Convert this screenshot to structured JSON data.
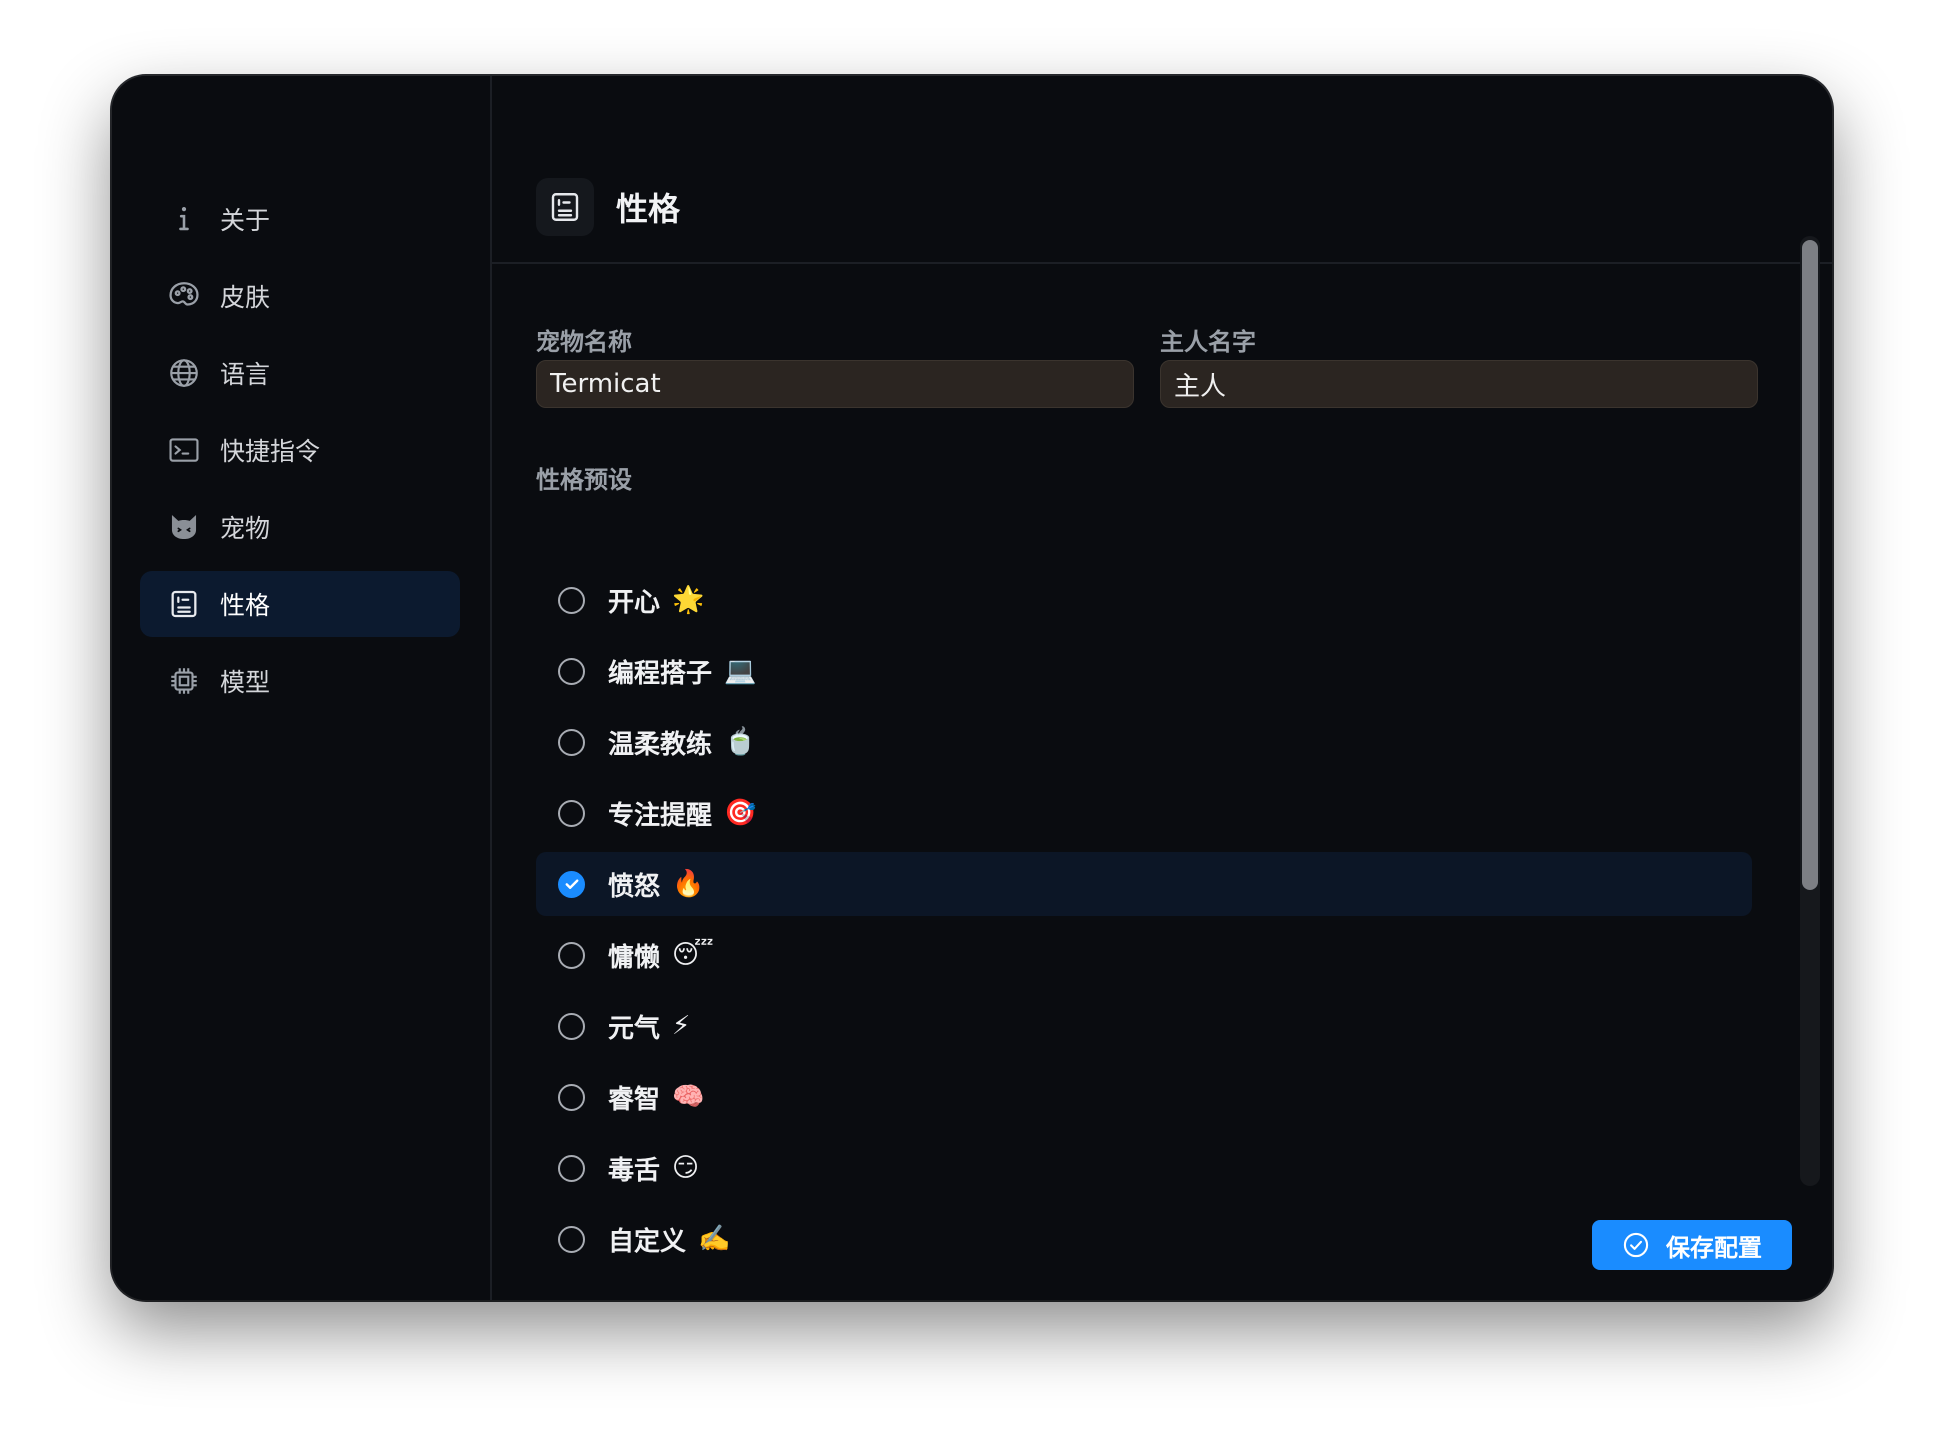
{
  "sidebar": {
    "items": [
      {
        "label": "关于",
        "icon": "info-icon"
      },
      {
        "label": "皮肤",
        "icon": "palette-icon"
      },
      {
        "label": "语言",
        "icon": "globe-icon"
      },
      {
        "label": "快捷指令",
        "icon": "terminal-icon"
      },
      {
        "label": "宠物",
        "icon": "cat-icon"
      },
      {
        "label": "性格",
        "icon": "personality-card-icon",
        "active": true
      },
      {
        "label": "模型",
        "icon": "chip-icon"
      }
    ]
  },
  "header": {
    "title": "性格",
    "icon": "personality-card-icon"
  },
  "form": {
    "pet_name": {
      "label": "宠物名称",
      "value": "Termicat"
    },
    "owner_name": {
      "label": "主人名字",
      "value": "主人"
    },
    "preset_label": "性格预设",
    "presets": [
      {
        "label": "开心",
        "emoji": "🌟",
        "selected": false
      },
      {
        "label": "编程搭子",
        "emoji": "💻",
        "selected": false
      },
      {
        "label": "温柔教练",
        "emoji": "🍵",
        "selected": false
      },
      {
        "label": "专注提醒",
        "emoji": "🎯",
        "selected": false
      },
      {
        "label": "愤怒",
        "emoji": "🔥",
        "selected": true
      },
      {
        "label": "慵懒",
        "emoji": "😴",
        "selected": false
      },
      {
        "label": "元气",
        "emoji": "⚡",
        "selected": false
      },
      {
        "label": "睿智",
        "emoji": "🧠",
        "selected": false
      },
      {
        "label": "毒舌",
        "emoji": "😏",
        "selected": false
      },
      {
        "label": "自定义",
        "emoji": "✍️",
        "selected": false
      }
    ]
  },
  "actions": {
    "save_label": "保存配置"
  },
  "colors": {
    "accent": "#1a8cff",
    "background": "#0a0c10",
    "input_bg": "#2b2521",
    "selected_row": "#0c1626"
  }
}
